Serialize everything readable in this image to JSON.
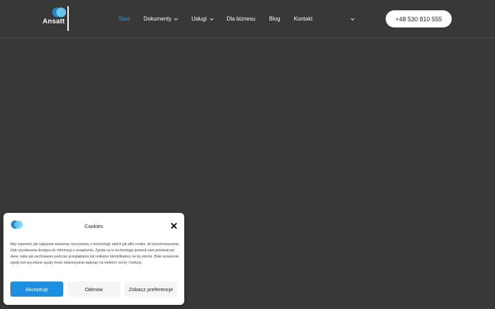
{
  "header": {
    "logo_text": "Ansatt",
    "nav": [
      {
        "label": "Start",
        "dropdown": false,
        "active": true
      },
      {
        "label": "Dokumenty",
        "dropdown": true,
        "active": false
      },
      {
        "label": "Usługi",
        "dropdown": true,
        "active": false
      },
      {
        "label": "Dla biznesu",
        "dropdown": false,
        "active": false
      },
      {
        "label": "Blog",
        "dropdown": false,
        "active": false
      },
      {
        "label": "Kontakt",
        "dropdown": false,
        "active": false
      }
    ],
    "phone": "+48 530 810 555",
    "accent_color": "#2e9be0"
  },
  "cookie": {
    "title": "Cookies",
    "close_icon": "close-icon",
    "body": "Aby zapewnić jak najlepsze wrażenia, korzystamy z technologii, takich jak pliki cookie, do przechowywania i/lub uzyskiwania dostępu do informacji o urządzeniu. Zgoda na te technologie pozwoli nam przetwarzać dane, takie jak zachowanie podczas przeglądania lub unikalne identyfikatory na tej stronie. Brak wyrażenia zgody lub wycofanie zgody może niekorzystnie wpłynąć na niektóre cechy i funkcje.",
    "accept_label": "Akceptuję",
    "deny_label": "Odmów",
    "prefs_label": "Zobacz preferencje",
    "accept_color": "#1b90e3"
  }
}
